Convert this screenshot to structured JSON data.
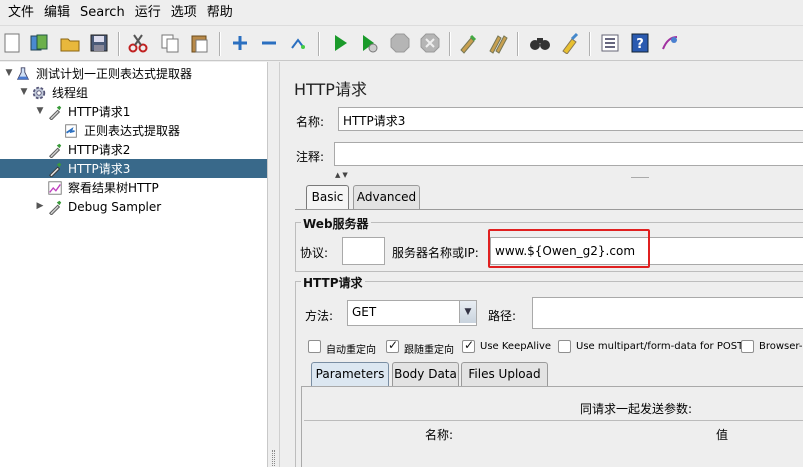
{
  "menubar": {
    "items": [
      {
        "label": "文件",
        "mnemonic_prefix": "",
        "mnemonic_rest": ""
      },
      {
        "label": "编辑"
      },
      {
        "label": "Search"
      },
      {
        "label": "运行"
      },
      {
        "label": "选项"
      },
      {
        "label": "帮助"
      }
    ]
  },
  "toolbar": {
    "icons": [
      "new-icon",
      "templates-icon",
      "open-icon",
      "save-icon",
      "cut-icon",
      "copy-icon",
      "paste-icon",
      "expand-icon",
      "collapse-icon",
      "toggle-icon",
      "start-icon",
      "start-no-pause-icon",
      "stop-icon",
      "shutdown-icon",
      "clear-icon",
      "clear-all-icon",
      "search-icon",
      "reset-search-icon",
      "function-helper-icon",
      "help-icon",
      "remote-icon"
    ]
  },
  "tree": {
    "nodes": [
      {
        "label": "测试计划一正则表达式提取器"
      },
      {
        "label": "线程组"
      },
      {
        "label": "HTTP请求1"
      },
      {
        "label": "正则表达式提取器"
      },
      {
        "label": "HTTP请求2"
      },
      {
        "label": "HTTP请求3"
      },
      {
        "label": "察看结果树HTTP"
      },
      {
        "label": "Debug Sampler"
      }
    ]
  },
  "panel": {
    "title": "HTTP请求",
    "name_label": "名称:",
    "name_value": "HTTP请求3",
    "comment_label": "注释:",
    "comment_value": "",
    "tabs": [
      {
        "label": "Basic"
      },
      {
        "label": "Advanced"
      }
    ],
    "web_server": {
      "title": "Web服务器",
      "protocol_label": "协议:",
      "protocol_value": "",
      "server_label": "服务器名称或IP:",
      "server_value": "www.${Owen_g2}.com"
    },
    "http_request": {
      "title": "HTTP请求",
      "method_label": "方法:",
      "method_value": "GET",
      "path_label": "路径:",
      "path_value": "",
      "checkboxes": [
        {
          "label": "自动重定向",
          "checked": false
        },
        {
          "label": "跟随重定向",
          "checked": true
        },
        {
          "label": "Use KeepAlive",
          "checked": true
        },
        {
          "label": "Use multipart/form-data for POST",
          "checked": false
        },
        {
          "label": "Browser-c",
          "checked": false
        }
      ],
      "subtabs": [
        {
          "label": "Parameters"
        },
        {
          "label": "Body Data"
        },
        {
          "label": "Files Upload"
        }
      ],
      "params_caption": "同请求一起发送参数:",
      "col_name": "名称:",
      "col_value": "值"
    }
  }
}
